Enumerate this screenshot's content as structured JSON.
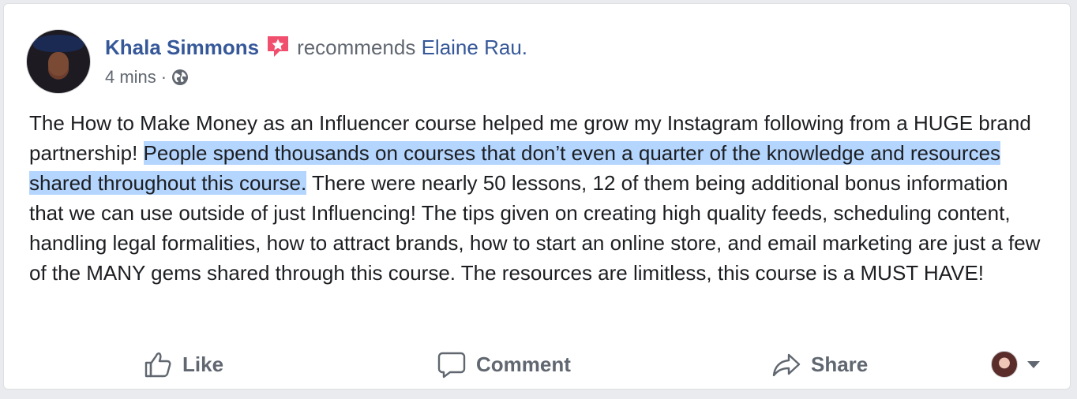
{
  "post": {
    "author": "Khala Simmons",
    "recommends_text": "recommends",
    "recommended_page": "Elaine Rau",
    "period": ".",
    "timestamp": "4 mins",
    "separator": "·",
    "privacy_icon": "globe-icon",
    "badge_icon": "recommendation-star-icon",
    "text_before": "The How to Make Money as an Influencer course helped me grow my Instagram following from a HUGE brand partnership! ",
    "text_highlighted": "People spend thousands on courses that don’t even a quarter of the knowledge and resources shared throughout this course.",
    "text_after": " There were nearly 50 lessons, 12 of them being additional bonus information that we can use outside of just Influencing! The tips given on creating high quality feeds, scheduling content, handling legal formalities, how to attract brands, how to start an online store, and email marketing are just a few of the MANY gems shared through this course. The resources are limitless, this course is a MUST HAVE!"
  },
  "actions": {
    "like": "Like",
    "comment": "Comment",
    "share": "Share"
  },
  "colors": {
    "link": "#365899",
    "meta": "#616770",
    "highlight": "#b4d5fe",
    "badge": "#f0506e"
  }
}
